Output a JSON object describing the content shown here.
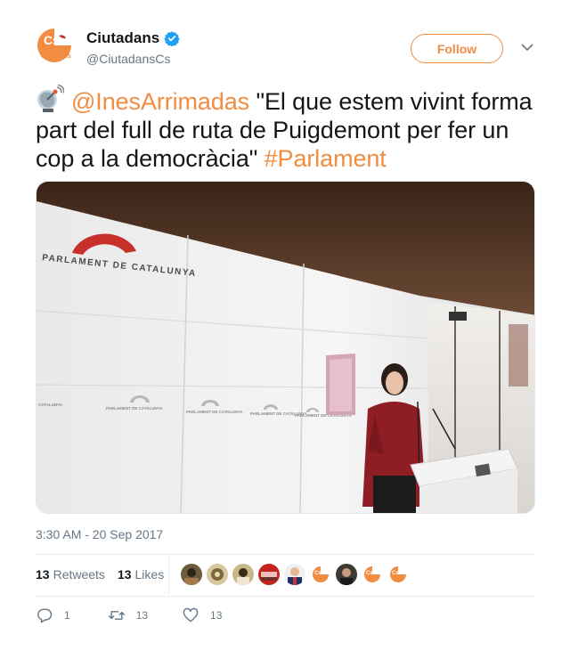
{
  "author": {
    "display_name": "Ciutadans",
    "handle": "@CiutadansCs",
    "avatar_text": "Cs",
    "avatar_subtext": "Ciutadans",
    "verified": true
  },
  "follow_label": "Follow",
  "tweet": {
    "icon": "satellite-antenna-icon",
    "mention": "@InesArrimadas",
    "text": " \"El que estem vivint forma part del full de ruta de Puigdemont per fer un cop a la democràcia\" ",
    "hashtag": "#Parlament"
  },
  "photo": {
    "main_sign": "PARLAMENT DE CATALUNYA",
    "small_signs": [
      "CATALUNYA",
      "PARLAMENT DE CATALUNYA",
      "PARLAMENT DE CATALUNYA",
      "PARLAMENT DE CATALUNYA",
      "PARLAMENT DE CATALUNYA"
    ]
  },
  "timestamp": "3:30 AM - 20 Sep 2017",
  "stats": {
    "retweets_count": "13",
    "retweets_label": "Retweets",
    "likes_count": "13",
    "likes_label": "Likes"
  },
  "actions": {
    "reply_count": "1",
    "retweet_count": "13",
    "like_count": "13"
  },
  "colors": {
    "brand": "#f28c41",
    "verified": "#1da1f2",
    "text": "#14171a",
    "muted": "#657786"
  }
}
